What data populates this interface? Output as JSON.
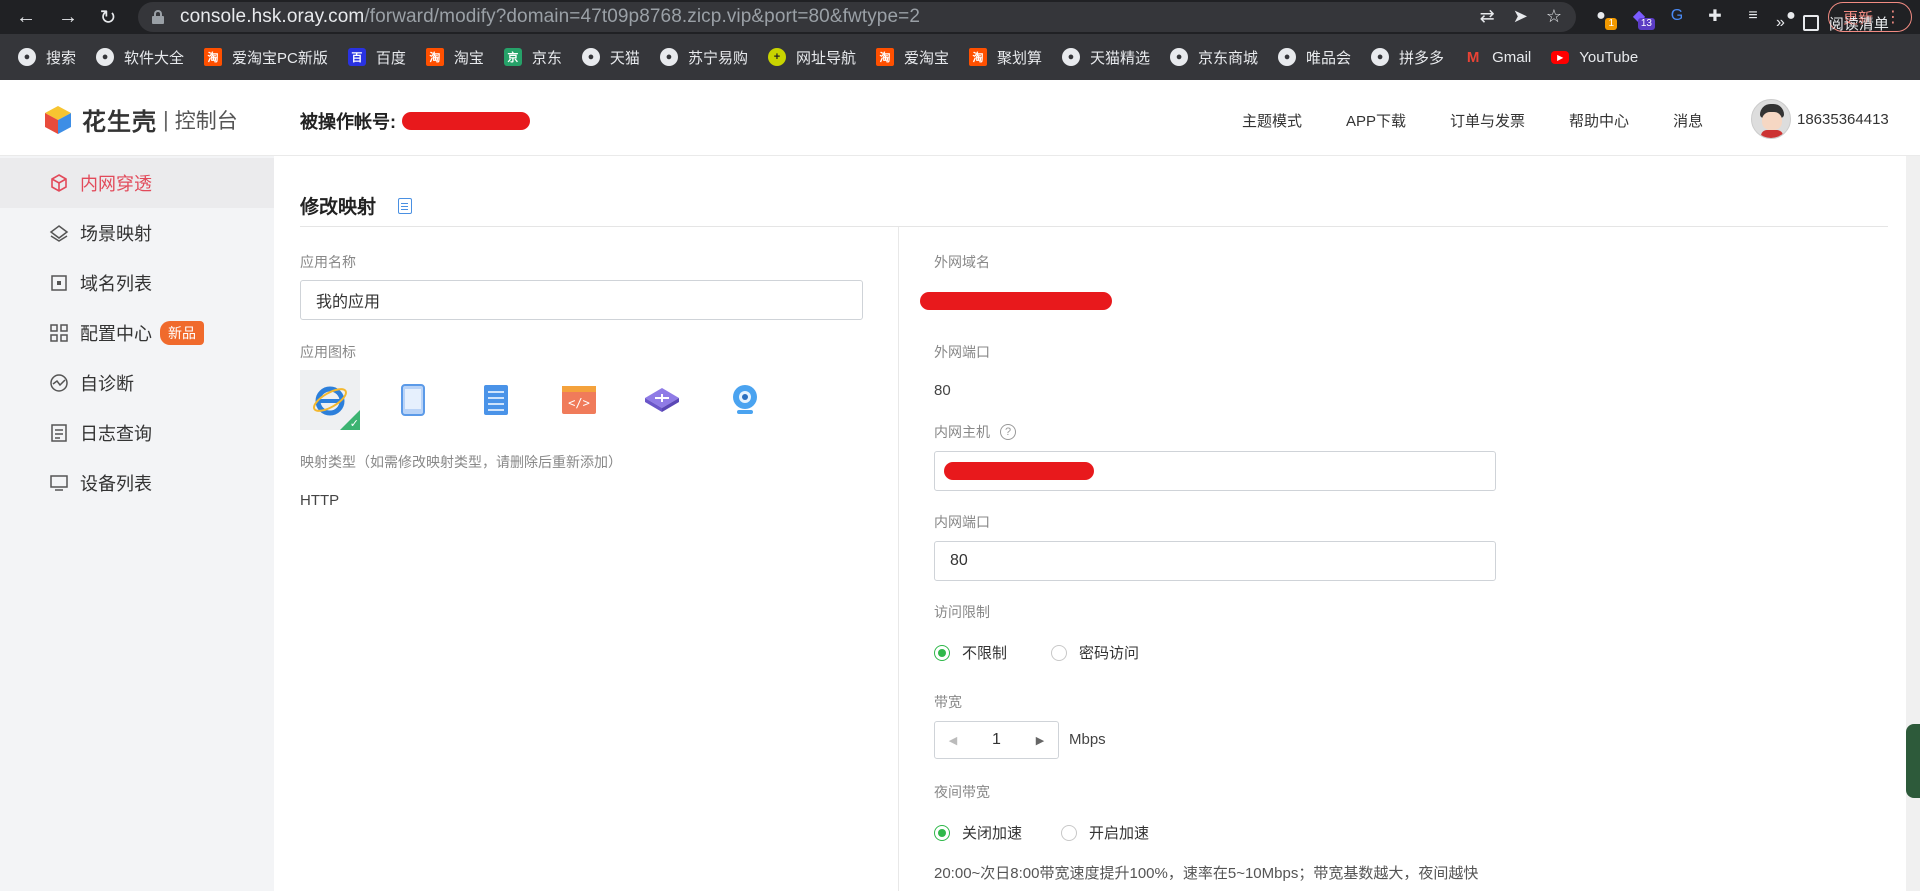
{
  "browser": {
    "url_host": "console.hsk.oray.com",
    "url_rest": "/forward/modify?domain=47t09p8768.zicp.vip&port=80&fwtype=2",
    "update_label": "更新",
    "ext_badges": [
      "1",
      "13"
    ]
  },
  "bookmarks": [
    {
      "label": "搜索",
      "icon": "globe-icon"
    },
    {
      "label": "软件大全",
      "icon": "globe-icon"
    },
    {
      "label": "爱淘宝PC新版",
      "icon": "taobao-icon"
    },
    {
      "label": "百度",
      "icon": "baidu-icon"
    },
    {
      "label": "淘宝",
      "icon": "taobao-icon"
    },
    {
      "label": "京东",
      "icon": "jd-icon"
    },
    {
      "label": "天猫",
      "icon": "globe-icon"
    },
    {
      "label": "苏宁易购",
      "icon": "globe-icon"
    },
    {
      "label": "网址导航",
      "icon": "plus-icon"
    },
    {
      "label": "爱淘宝",
      "icon": "taobao-icon"
    },
    {
      "label": "聚划算",
      "icon": "taobao-icon"
    },
    {
      "label": "天猫精选",
      "icon": "globe-icon"
    },
    {
      "label": "京东商城",
      "icon": "globe-icon"
    },
    {
      "label": "唯品会",
      "icon": "globe-icon"
    },
    {
      "label": "拼多多",
      "icon": "globe-icon"
    },
    {
      "label": "Gmail",
      "icon": "gmail-icon"
    },
    {
      "label": "YouTube",
      "icon": "youtube-icon"
    }
  ],
  "bookmarks_overflow": "»",
  "reading_list": "阅读清单",
  "header": {
    "logo_text": "花生壳",
    "logo_sep": "|",
    "logo_sub": "控制台",
    "operator_label": "被操作帐号:",
    "nav": [
      "主题模式",
      "APP下载",
      "订单与发票",
      "帮助中心",
      "消息"
    ],
    "username": "18635364413"
  },
  "sidebar": {
    "items": [
      {
        "label": "内网穿透",
        "active": true
      },
      {
        "label": "场景映射"
      },
      {
        "label": "域名列表"
      },
      {
        "label": "配置中心",
        "tag": "新品"
      },
      {
        "label": "自诊断"
      },
      {
        "label": "日志查询"
      },
      {
        "label": "设备列表"
      }
    ]
  },
  "form": {
    "title": "修改映射",
    "app_name_label": "应用名称",
    "app_name_value": "我的应用",
    "app_icon_label": "应用图标",
    "app_icons": [
      "ie-icon",
      "tablet-icon",
      "server-icon",
      "code-icon",
      "router-icon",
      "webcam-icon"
    ],
    "map_type_label": "映射类型（如需修改映射类型，请删除后重新添加）",
    "map_type_value": "HTTP",
    "ext_domain_label": "外网域名",
    "ext_port_label": "外网端口",
    "ext_port_value": "80",
    "int_host_label": "内网主机",
    "int_host_help": "?",
    "int_port_label": "内网端口",
    "int_port_value": "80",
    "access_label": "访问限制",
    "access_options": [
      "不限制",
      "密码访问"
    ],
    "bandwidth_label": "带宽",
    "bandwidth_value": "1",
    "bandwidth_unit": "Mbps",
    "night_label": "夜间带宽",
    "night_options": [
      "关闭加速",
      "开启加速"
    ],
    "night_note": "20:00~次日8:00带宽速度提升100%，速率在5~10Mbps；带宽基数越大，夜间越快"
  },
  "colors": {
    "accent_red": "#e24a5a",
    "radio_green": "#2fb84a",
    "redaction": "#e8191c",
    "new_tag": "#f06a2c"
  }
}
